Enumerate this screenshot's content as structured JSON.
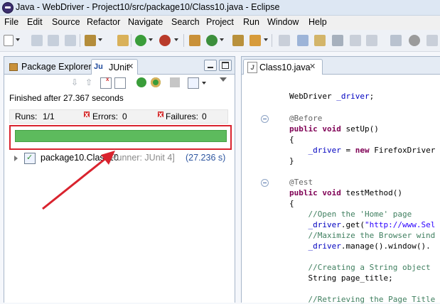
{
  "window": {
    "title": "Java - WebDriver - Project10/src/package10/Class10.java - Eclipse"
  },
  "menu": [
    "File",
    "Edit",
    "Source",
    "Refactor",
    "Navigate",
    "Search",
    "Project",
    "Run",
    "Window",
    "Help"
  ],
  "left_panel": {
    "tabs": [
      {
        "label": "Package Explorer",
        "active": false
      },
      {
        "label": "JUnit",
        "active": true
      }
    ],
    "status": "Finished after 27.367 seconds",
    "runs_label": "Runs:",
    "runs_value": "1/1",
    "errors_label": "Errors:",
    "errors_value": "0",
    "failures_label": "Failures:",
    "failures_value": "0",
    "progress_fraction": 1.0,
    "progress_color": "#5dbb5d",
    "test_tree": {
      "name": "package10.Class10",
      "runner": "[Runner: JUnit 4]",
      "time": "(27.236 s)"
    }
  },
  "editor": {
    "tab_label": "Class10.java",
    "lines": [
      {
        "parts": [
          {
            "text": "WebDriver "
          },
          {
            "text": "_driver",
            "cls": "f"
          },
          {
            "text": ";"
          }
        ]
      },
      {
        "parts": [
          {
            "text": "@Before",
            "cls": "a"
          }
        ],
        "fold": true
      },
      {
        "parts": [
          {
            "text": "public",
            "cls": "k"
          },
          {
            "text": " "
          },
          {
            "text": "void",
            "cls": "k"
          },
          {
            "text": " setUp()"
          }
        ]
      },
      {
        "parts": [
          {
            "text": "{"
          }
        ]
      },
      {
        "parts": [
          {
            "text": "    "
          },
          {
            "text": "_driver",
            "cls": "f"
          },
          {
            "text": " = "
          },
          {
            "text": "new",
            "cls": "k"
          },
          {
            "text": " FirefoxDriver"
          }
        ]
      },
      {
        "parts": [
          {
            "text": "}"
          }
        ]
      },
      {
        "parts": [
          {
            "text": "@Test",
            "cls": "a"
          }
        ],
        "fold": true
      },
      {
        "parts": [
          {
            "text": "public",
            "cls": "k"
          },
          {
            "text": " "
          },
          {
            "text": "void",
            "cls": "k"
          },
          {
            "text": " testMethod()"
          }
        ]
      },
      {
        "parts": [
          {
            "text": "{"
          }
        ]
      },
      {
        "parts": [
          {
            "text": "    //Open the 'Home' page",
            "cls": "c"
          }
        ]
      },
      {
        "parts": [
          {
            "text": "    "
          },
          {
            "text": "_driver",
            "cls": "f"
          },
          {
            "text": ".get("
          },
          {
            "text": "\"http://www.Sel",
            "cls": "s"
          }
        ]
      },
      {
        "parts": [
          {
            "text": "    //Maximize the Browser wind",
            "cls": "c"
          }
        ]
      },
      {
        "parts": [
          {
            "text": "    "
          },
          {
            "text": "_driver",
            "cls": "f"
          },
          {
            "text": ".manage().window()."
          }
        ]
      },
      {
        "parts": [
          {
            "text": "    //Creating a String object",
            "cls": "c"
          }
        ]
      },
      {
        "parts": [
          {
            "text": "    String page_title;"
          }
        ]
      },
      {
        "parts": [
          {
            "text": "    //Retrieving the Page Title",
            "cls": "c"
          }
        ]
      }
    ]
  },
  "annotation": {
    "color": "#d9232e"
  }
}
